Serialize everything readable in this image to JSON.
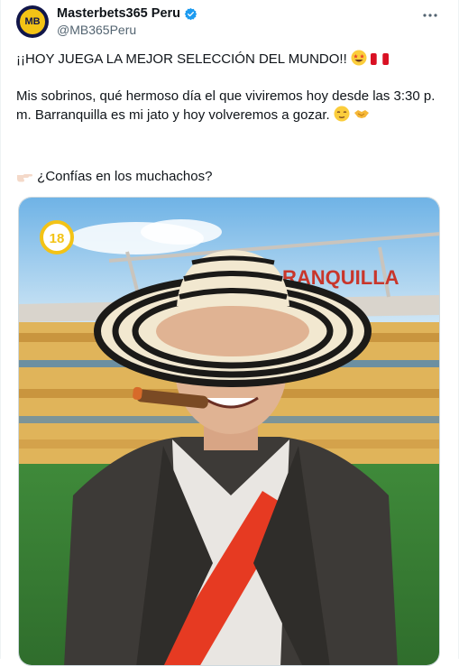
{
  "account": {
    "display_name": "Masterbets365 Peru",
    "handle": "@MB365Peru",
    "avatar_text": "MB"
  },
  "tweet": {
    "line1": "¡¡HOY JUEGA LA MEJOR SELECCIÓN DEL MUNDO!!",
    "para2": "Mis sobrinos, qué hermoso día el que viviremos hoy desde las 3:30 p. m. Barranquilla es mi jato y hoy volveremos a gozar.",
    "line3": "¿Confías en los muchachos?"
  },
  "media": {
    "age_badge": "18",
    "stadium_sign": "RANQUILLA"
  },
  "colors": {
    "verified": "#1d9bf0",
    "brand_yellow": "#f3c316",
    "brand_navy": "#11164a",
    "peru_red": "#e63a22"
  }
}
